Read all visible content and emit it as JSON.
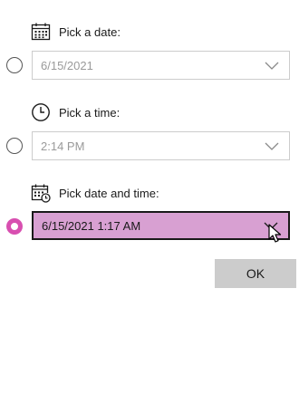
{
  "date_section": {
    "label": "Pick a date:",
    "icon": "calendar-icon",
    "value": "6/15/2021",
    "selected": false,
    "enabled": false
  },
  "time_section": {
    "label": "Pick a time:",
    "icon": "clock-icon",
    "value": "2:14 PM",
    "selected": false,
    "enabled": false
  },
  "datetime_section": {
    "label": "Pick date and time:",
    "icon": "calendar-clock-icon",
    "value": "6/15/2021 1:17 AM",
    "selected": true,
    "enabled": true
  },
  "actions": {
    "ok_label": "OK"
  },
  "colors": {
    "accent": "#d84fb0",
    "active_field_background": "#d8a0d2",
    "ok_button_background": "#cccccc"
  }
}
